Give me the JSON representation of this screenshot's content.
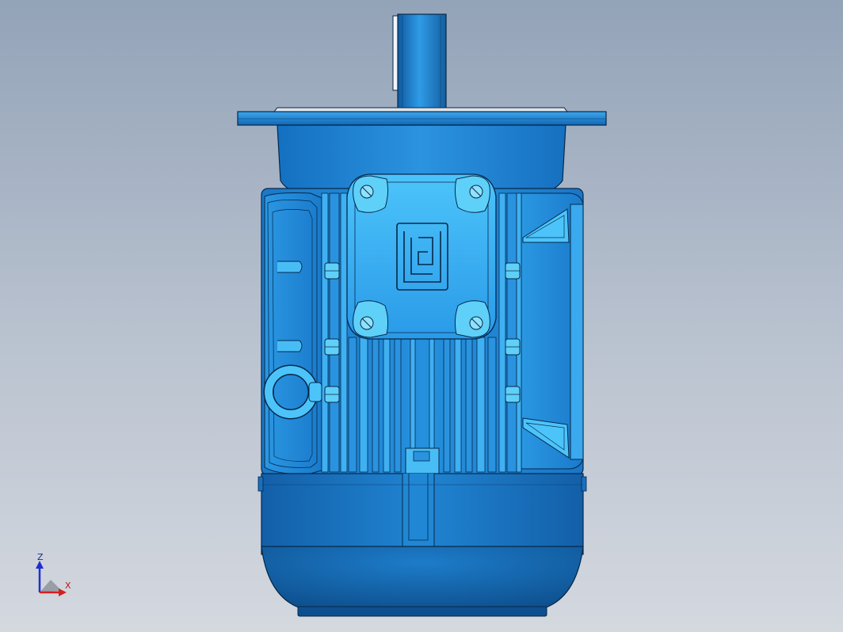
{
  "viewport": {
    "model": "motor",
    "background_top": "#93a3b8",
    "background_bottom": "#d4d8df"
  },
  "colors": {
    "body_main": "#1e7fd0",
    "body_light": "#3fb0f2",
    "body_dark": "#0e4f91",
    "edge_line": "#06284a",
    "bolt": "#5fd0f8",
    "triad_x": "#d22020",
    "triad_z": "#1f2fd0"
  },
  "triad": {
    "x_label": "X",
    "z_label": "Z"
  }
}
